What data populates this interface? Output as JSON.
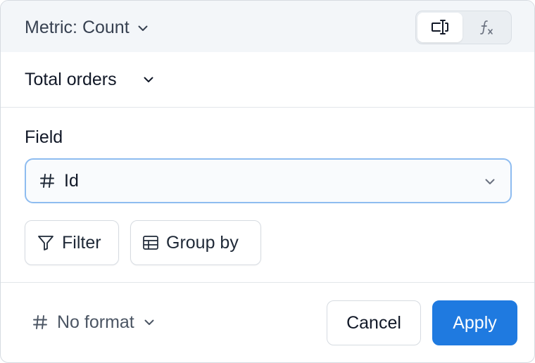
{
  "header": {
    "metric_label": "Metric: Count",
    "modes": [
      {
        "icon": "text-cursor-input-icon",
        "active": true
      },
      {
        "icon": "function-icon",
        "active": false
      }
    ]
  },
  "metric": {
    "name": "Total orders"
  },
  "field": {
    "label": "Field",
    "type_icon": "hash-icon",
    "value": "Id"
  },
  "actions": {
    "filter_label": "Filter",
    "group_by_label": "Group by"
  },
  "footer": {
    "format_label": "No format",
    "cancel_label": "Cancel",
    "apply_label": "Apply"
  },
  "colors": {
    "primary": "#1f7ae0",
    "focus_border": "#8ebcf0",
    "header_bg": "#f3f6f9"
  }
}
